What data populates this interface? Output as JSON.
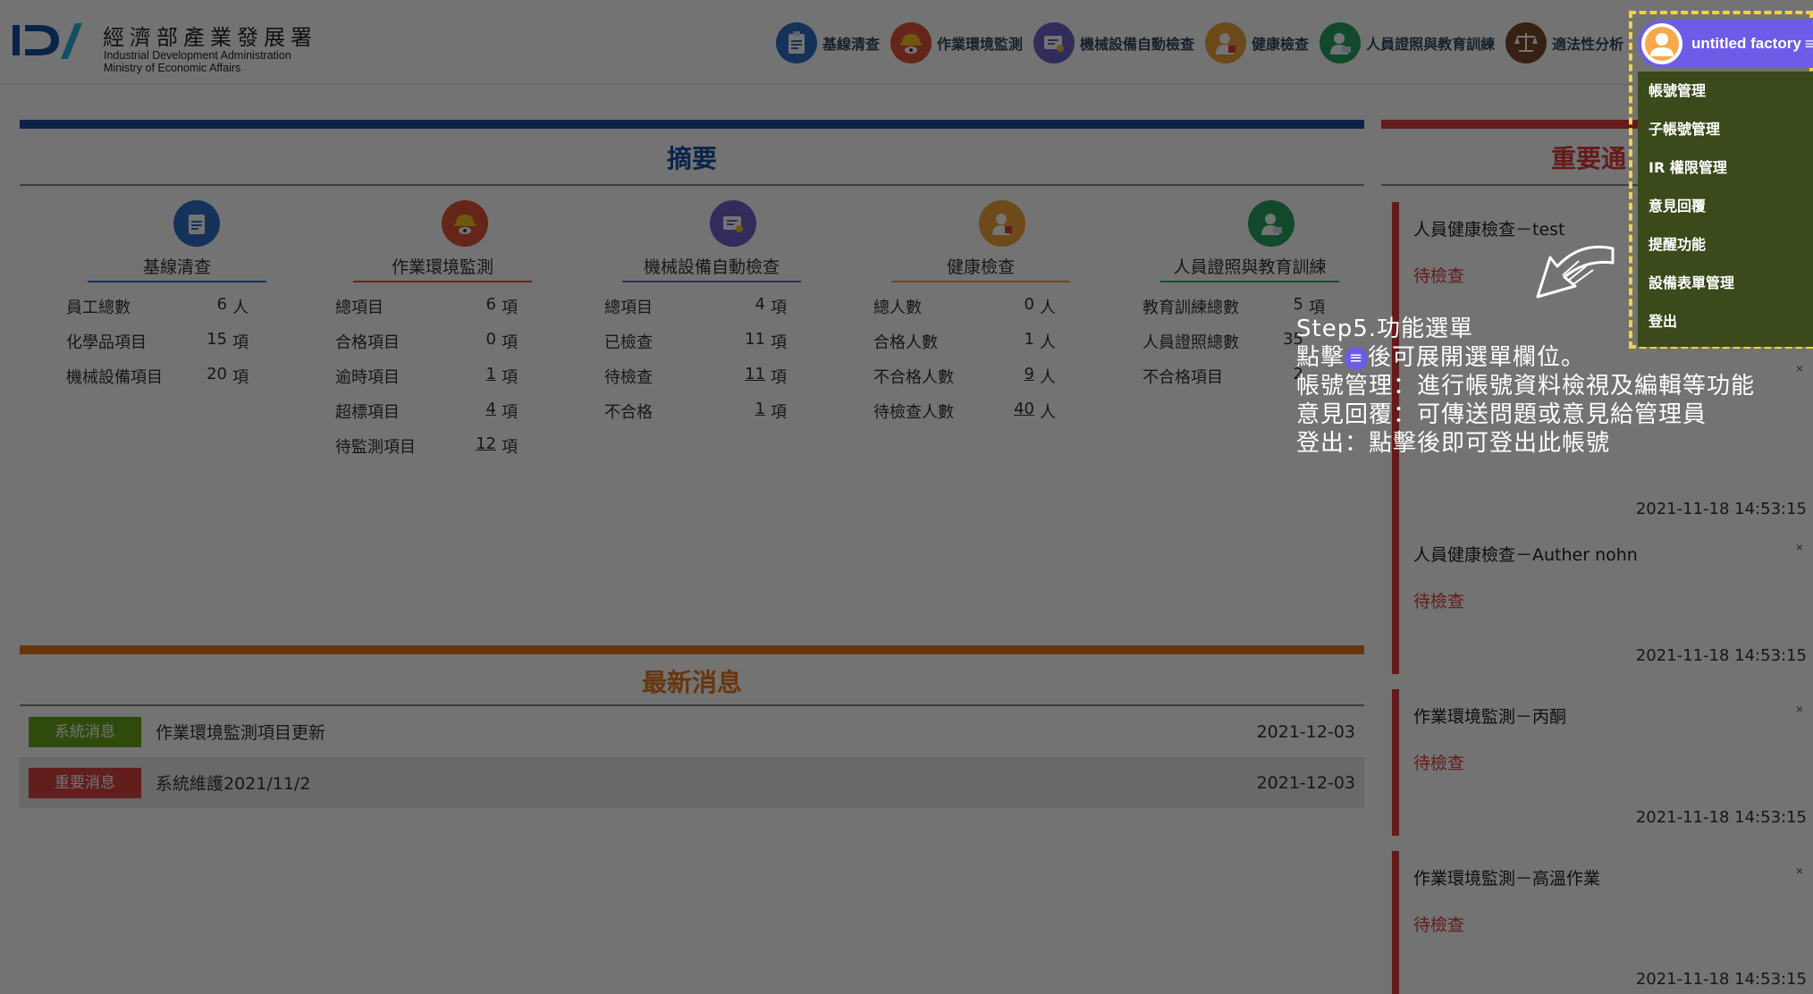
{
  "header": {
    "logo_zh": "經濟部產業發展署",
    "logo_en_line1": "Industrial Development Administration",
    "logo_en_line2": "Ministry of Economic Affairs",
    "nav": [
      {
        "label": "基線清查",
        "icon": "clipboard-icon",
        "color": "#2f6fc9"
      },
      {
        "label": "作業環境監測",
        "icon": "hardhat-icon",
        "color": "#e0523a"
      },
      {
        "label": "機械設備自動檢查",
        "icon": "machine-icon",
        "color": "#6e63c9"
      },
      {
        "label": "健康檢查",
        "icon": "health-icon",
        "color": "#f0a43a"
      },
      {
        "label": "人員證照與教育訓練",
        "icon": "training-icon",
        "color": "#29a35f"
      },
      {
        "label": "適法性分析",
        "icon": "scales-icon",
        "color": "#7a4a2a"
      }
    ]
  },
  "user_menu": {
    "name": "untitled factory",
    "items": [
      "帳號管理",
      "子帳號管理",
      "IR 權限管理",
      "意見回覆",
      "提醒功能",
      "設備表單管理",
      "登出"
    ]
  },
  "summary": {
    "title": "摘要",
    "columns": [
      {
        "title": "基線清查",
        "icon": "clipboard-icon",
        "color": "#2f6fc9",
        "rows": [
          {
            "label": "員工總數",
            "value": "6",
            "unit": "人"
          },
          {
            "label": "化學品項目",
            "value": "15",
            "unit": "項"
          },
          {
            "label": "機械設備項目",
            "value": "20",
            "unit": "項"
          }
        ]
      },
      {
        "title": "作業環境監測",
        "icon": "hardhat-icon",
        "color": "#e0523a",
        "rows": [
          {
            "label": "總項目",
            "value": "6",
            "unit": "項"
          },
          {
            "label": "合格項目",
            "value": "0",
            "unit": "項"
          },
          {
            "label": "逾時項目",
            "value": "1",
            "unit": "項",
            "link": true
          },
          {
            "label": "超標項目",
            "value": "4",
            "unit": "項",
            "link": true
          },
          {
            "label": "待監測項目",
            "value": "12",
            "unit": "項",
            "link": true
          }
        ]
      },
      {
        "title": "機械設備自動檢查",
        "icon": "machine-icon",
        "color": "#6e63c9",
        "rows": [
          {
            "label": "總項目",
            "value": "4",
            "unit": "項"
          },
          {
            "label": "已檢查",
            "value": "11",
            "unit": "項"
          },
          {
            "label": "待檢查",
            "value": "11",
            "unit": "項",
            "link": true
          },
          {
            "label": "不合格",
            "value": "1",
            "unit": "項",
            "link": true
          }
        ]
      },
      {
        "title": "健康檢查",
        "icon": "health-icon",
        "color": "#f0a43a",
        "rows": [
          {
            "label": "總人數",
            "value": "0",
            "unit": "人"
          },
          {
            "label": "合格人數",
            "value": "1",
            "unit": "人"
          },
          {
            "label": "不合格人數",
            "value": "9",
            "unit": "人",
            "link": true
          },
          {
            "label": "待檢查人數",
            "value": "40",
            "unit": "人",
            "link": true
          }
        ]
      },
      {
        "title": "人員證照與教育訓練",
        "icon": "training-icon",
        "color": "#29a35f",
        "rows": [
          {
            "label": "教育訓練總數",
            "value": "5",
            "unit": "項"
          },
          {
            "label": "人員證照總數",
            "value": "35",
            "unit": ""
          },
          {
            "label": "不合格項目",
            "value": "2",
            "unit": ""
          }
        ]
      }
    ]
  },
  "news": {
    "title": "最新消息",
    "items": [
      {
        "badge": "系統消息",
        "badge_color": "#6aa51e",
        "text": "作業環境監測項目更新",
        "date": "2021-12-03"
      },
      {
        "badge": "重要消息",
        "badge_color": "#d94040",
        "text": "系統維護2021/11/2",
        "date": "2021-12-03"
      }
    ]
  },
  "notifications": {
    "title": "重要通",
    "items": [
      {
        "title": "人員健康檢查－test",
        "status": "待檢查",
        "time": "2021-11-18 14:53:15"
      },
      {
        "title": "人員健康檢查－Auther nohn",
        "status": "待檢查",
        "time": "2021-11-18 14:53:15"
      },
      {
        "title": "作業環境監測－丙酮",
        "status": "待檢查",
        "time": "2021-11-18 14:53:15"
      },
      {
        "title": "作業環境監測－高溫作業",
        "status": "待檢查",
        "time": "2021-11-18 14:53:15"
      }
    ]
  },
  "tutorial": {
    "line1": "Step5.功能選單",
    "line2_pre": "點擊",
    "line2_post": "後可展開選單欄位。",
    "line3": "帳號管理：進行帳號資料檢視及編輯等功能",
    "line4": "意見回覆：可傳送問題或意見給管理員",
    "line5": "登出：點擊後即可登出此帳號"
  }
}
